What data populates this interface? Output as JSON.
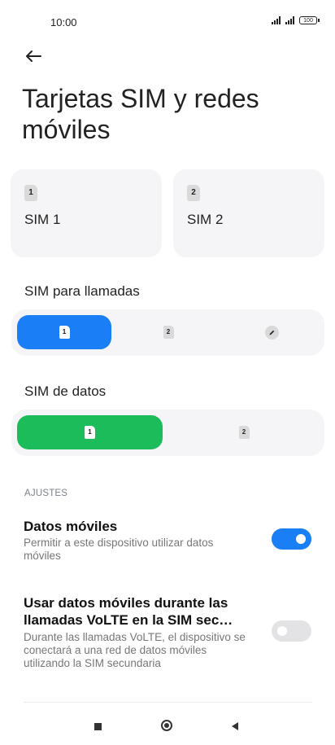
{
  "status_bar": {
    "time": "10:00",
    "battery": "100"
  },
  "header": {
    "title": "Tarjetas SIM y redes móviles"
  },
  "sim_cards": [
    {
      "chip": "1",
      "name": "SIM 1"
    },
    {
      "chip": "2",
      "name": "SIM 2"
    }
  ],
  "calls": {
    "label": "SIM para llamadas",
    "options": [
      "1",
      "2"
    ],
    "selected": "1",
    "accent": "#1a7ff5"
  },
  "data": {
    "label": "SIM de datos",
    "options": [
      "1",
      "2"
    ],
    "selected": "1",
    "accent": "#1cbc5a"
  },
  "settings": {
    "section_label": "AJUSTES",
    "mobile_data": {
      "title": "Datos móviles",
      "description": "Permitir a este dispositivo utilizar datos móviles",
      "enabled": true
    },
    "volte_data": {
      "title": "Usar datos móviles durante las llamadas VoLTE en la SIM sec…",
      "description": "Durante las llamadas VoLTE, el dispositivo se conectará a una red de datos móviles utilizando la SIM secundaria",
      "enabled": false
    }
  },
  "colors": {
    "toggle_on": "#1a7ff5",
    "toggle_off": "#e3e3e5"
  }
}
